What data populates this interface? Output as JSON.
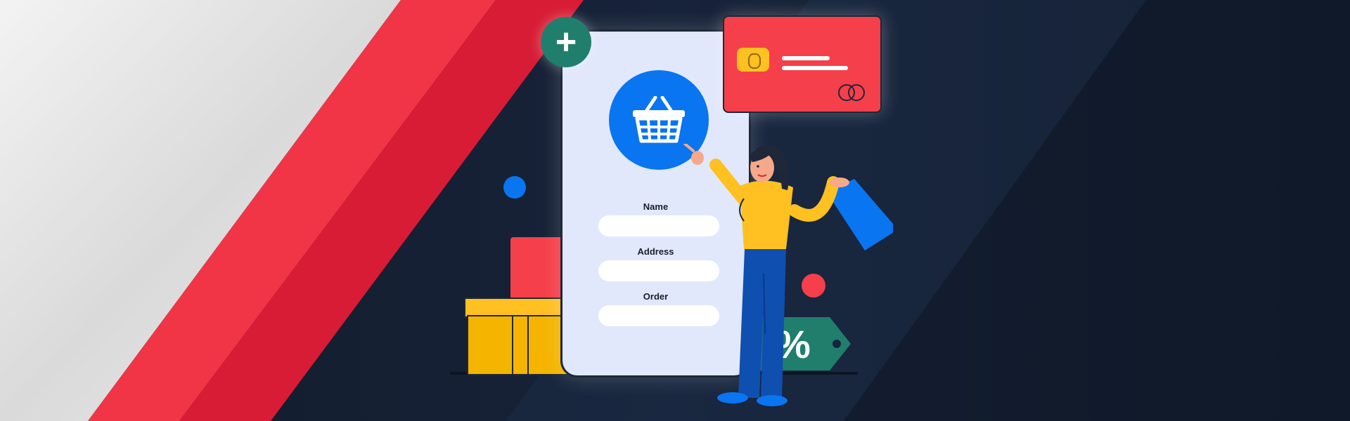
{
  "scene": {
    "colors": {
      "accent_red": "#f23447",
      "accent_red_dark": "#d81c35",
      "navy": "#172232",
      "phone_bg": "#e1e8fb",
      "blue": "#0a75f0",
      "teal": "#1f7f6c",
      "yellow": "#ffc021"
    },
    "phone": {
      "fields": [
        {
          "label": "Name"
        },
        {
          "label": "Address"
        },
        {
          "label": "Order"
        }
      ]
    },
    "plus_button": {
      "symbol": "+"
    },
    "discount_tag": {
      "symbol": "%"
    },
    "icons": [
      "basket-icon",
      "plus-icon",
      "credit-card-icon",
      "shopping-bag-icon",
      "gift-box-icon",
      "discount-tag-icon"
    ]
  }
}
